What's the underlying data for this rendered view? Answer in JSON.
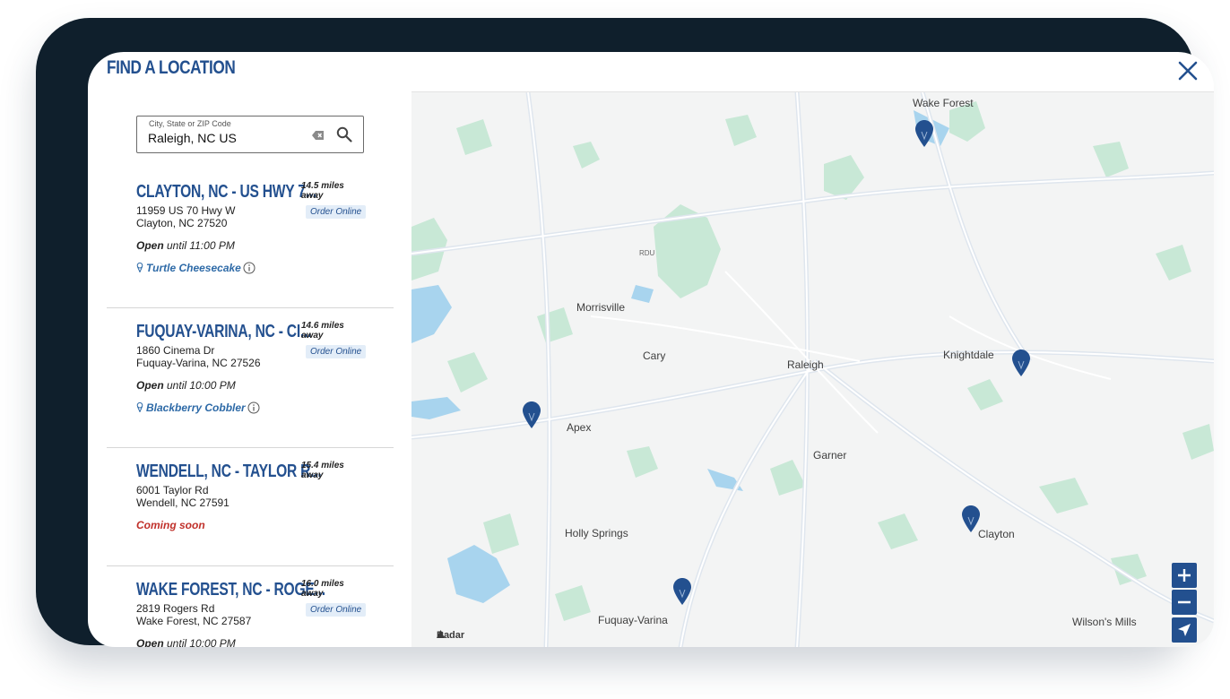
{
  "header": {
    "title": "FIND A LOCATION"
  },
  "search": {
    "label": "City, State or ZIP Code",
    "value": "Raleigh, NC US"
  },
  "locations": [
    {
      "name": "CLAYTON, NC - US HWY 7...",
      "address1": "11959 US 70 Hwy W",
      "address2": "Clayton, NC 27520",
      "distance1": "14.5 miles",
      "distance2": "away",
      "order": "Order Online",
      "status_bold": "Open",
      "status_rest": " until 11:00 PM",
      "flavor": "Turtle Cheesecake"
    },
    {
      "name": "FUQUAY-VARINA, NC - CI...",
      "address1": "1860 Cinema Dr",
      "address2": "Fuquay-Varina, NC 27526",
      "distance1": "14.6 miles",
      "distance2": "away",
      "order": "Order Online",
      "status_bold": "Open",
      "status_rest": " until 10:00 PM",
      "flavor": "Blackberry Cobbler"
    },
    {
      "name": "WENDELL, NC - TAYLOR R...",
      "address1": "6001 Taylor Rd",
      "address2": "Wendell, NC 27591",
      "distance1": "15.4 miles",
      "distance2": "away",
      "coming_soon": "Coming soon"
    },
    {
      "name": "WAKE FOREST, NC - ROGE...",
      "address1": "2819 Rogers Rd",
      "address2": "Wake Forest, NC 27587",
      "distance1": "16.0 miles",
      "distance2": "away",
      "order": "Order Online",
      "status_bold": "Open",
      "status_rest": " until 10:00 PM"
    }
  ],
  "map": {
    "places": [
      "Wake Forest",
      "RDU",
      "Morrisville",
      "Cary",
      "Raleigh",
      "Knightdale",
      "Apex",
      "Garner",
      "Holly Springs",
      "Clayton",
      "Fuquay-Varina",
      "Wilson's Mills"
    ],
    "attribution": "Radar",
    "pin_color": "#23508f",
    "water_color": "#a8d4ee",
    "park_color": "#c8e8d6"
  },
  "colors": {
    "brand": "#23508f",
    "device": "#0f1f2c",
    "coming_soon": "#c0302a"
  },
  "icons": [
    "close-icon",
    "clear-icon",
    "search-icon",
    "ice-cream-cone-icon",
    "info-icon",
    "map-pin-icon",
    "plus-icon",
    "minus-icon",
    "locate-arrow-icon"
  ]
}
